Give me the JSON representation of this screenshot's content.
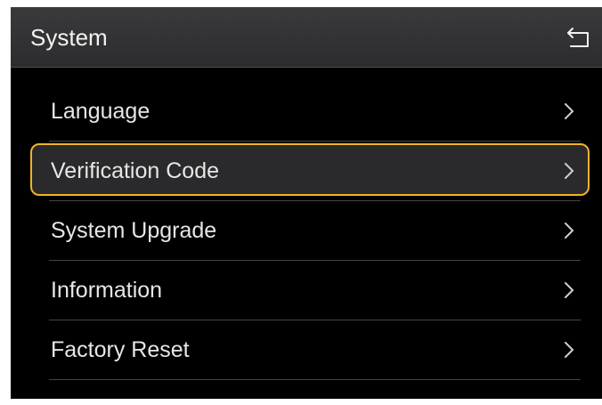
{
  "header": {
    "title": "System",
    "back_icon": "back-arrow-icon"
  },
  "menu": {
    "items": [
      {
        "label": "Language",
        "icon": "chevron-right-icon",
        "selected": false
      },
      {
        "label": "Verification Code",
        "icon": "chevron-right-icon",
        "selected": true
      },
      {
        "label": "System Upgrade",
        "icon": "chevron-right-icon",
        "selected": false
      },
      {
        "label": "Information",
        "icon": "chevron-right-icon",
        "selected": false
      },
      {
        "label": "Factory Reset",
        "icon": "chevron-right-icon",
        "selected": false
      }
    ]
  },
  "colors": {
    "background": "#000000",
    "header": "#333335",
    "accent": "#f0b429",
    "text": "#e6e6e6"
  }
}
